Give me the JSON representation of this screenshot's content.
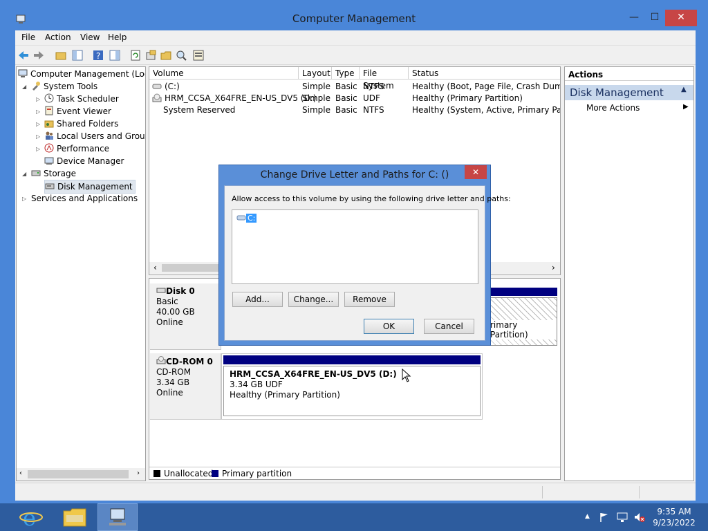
{
  "window": {
    "title": "Computer Management",
    "controls": {
      "minimize": "—",
      "maximize": "☐",
      "close": "✕"
    }
  },
  "menu": [
    "File",
    "Action",
    "View",
    "Help"
  ],
  "tree": {
    "root": "Computer Management (Local",
    "system_tools": "System Tools",
    "task_scheduler": "Task Scheduler",
    "event_viewer": "Event Viewer",
    "shared_folders": "Shared Folders",
    "local_users": "Local Users and Groups",
    "performance": "Performance",
    "device_manager": "Device Manager",
    "storage": "Storage",
    "disk_management": "Disk Management",
    "services": "Services and Applications"
  },
  "volume_table": {
    "headers": [
      "Volume",
      "Layout",
      "Type",
      "File System",
      "Status"
    ],
    "rows": [
      [
        "(C:)",
        "Simple",
        "Basic",
        "NTFS",
        "Healthy (Boot, Page File, Crash Dump, Pr"
      ],
      [
        "HRM_CCSA_X64FRE_EN-US_DV5 (D:)",
        "Simple",
        "Basic",
        "UDF",
        "Healthy (Primary Partition)"
      ],
      [
        "System Reserved",
        "Simple",
        "Basic",
        "NTFS",
        "Healthy (System, Active, Primary Partitio"
      ]
    ]
  },
  "disks": {
    "disk0": {
      "name": "Disk 0",
      "type": "Basic",
      "size": "40.00 GB",
      "status": "Online",
      "partition_tail": "rimary Partition)"
    },
    "cdrom0": {
      "name": "CD-ROM 0",
      "type": "CD-ROM",
      "size": "3.34 GB",
      "status": "Online",
      "vol_name": "HRM_CCSA_X64FRE_EN-US_DV5  (D:)",
      "vol_size": "3.34 GB UDF",
      "vol_status": "Healthy (Primary Partition)"
    }
  },
  "legend": {
    "unallocated": "Unallocated",
    "primary": "Primary partition"
  },
  "actions": {
    "header": "Actions",
    "section": "Disk Management",
    "more": "More Actions"
  },
  "dialog": {
    "title": "Change Drive Letter and Paths for C: ()",
    "instruction": "Allow access to this volume by using the following drive letter and paths:",
    "list_item": "C:",
    "add": "Add...",
    "change": "Change...",
    "remove": "Remove",
    "ok": "OK",
    "cancel": "Cancel"
  },
  "taskbar": {
    "time": "9:35 AM",
    "date": "9/23/2022"
  },
  "colors": {
    "frame": "#4a86d8",
    "primary_partition": "#000080",
    "taskbar": "#2d5c9e"
  }
}
